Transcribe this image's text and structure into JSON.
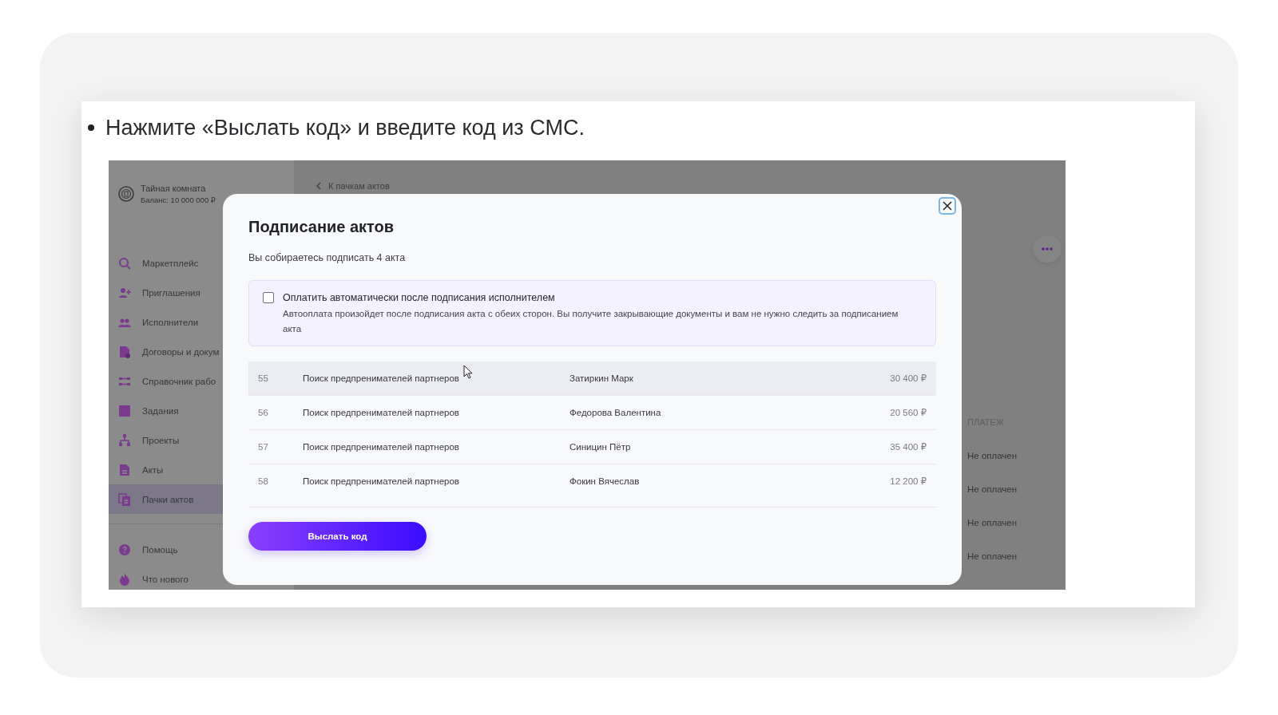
{
  "instruction": "Нажмите «Выслать код» и введите код из СМС.",
  "screenshot": {
    "sidebar": {
      "account": {
        "name": "Тайная комната",
        "balance": "Баланс: 10 000 000 ₽"
      },
      "items": [
        {
          "label": "Маркетплейс",
          "selected": false
        },
        {
          "label": "Приглашения",
          "selected": false
        },
        {
          "label": "Исполнители",
          "selected": false
        },
        {
          "label": "Договоры и докум",
          "selected": false
        },
        {
          "label": "Справочник рабо",
          "selected": false
        },
        {
          "label": "Задания",
          "selected": false
        },
        {
          "label": "Проекты",
          "selected": false
        },
        {
          "label": "Акты",
          "selected": false
        },
        {
          "label": "Пачки актов",
          "selected": true
        }
      ],
      "footer_items": [
        {
          "label": "Помощь",
          "selected": false
        },
        {
          "label": "Что нового",
          "selected": false
        }
      ]
    },
    "main": {
      "back_link": "К пачкам актов",
      "payment_column": {
        "header": "ПЛАТЕЖ",
        "values": [
          "Не оплачен",
          "Не оплачен",
          "Не оплачен",
          "Не оплачен"
        ]
      }
    },
    "modal": {
      "title": "Подписание актов",
      "subtitle": "Вы собираетесь подписать 4 акта",
      "auto_pay": {
        "checked": false,
        "label": "Оплатить автоматически после подписания исполнителем",
        "description": "Автооплата произойдет после подписания акта с обеих сторон. Вы получите закрывающие документы и вам не нужно следить за подписанием акта"
      },
      "table": {
        "rows": [
          {
            "number": "55",
            "task": "Поиск предпренимателей партнеров",
            "performer": "Затиркин Марк",
            "amount": "30 400 ₽",
            "hovered": true
          },
          {
            "number": "56",
            "task": "Поиск предпренимателей партнеров",
            "performer": "Федорова Валентина",
            "amount": "20 560 ₽",
            "hovered": false
          },
          {
            "number": "57",
            "task": "Поиск предпренимателей партнеров",
            "performer": "Синицин Пётр",
            "amount": "35 400 ₽",
            "hovered": false
          },
          {
            "number": "58",
            "task": "Поиск предпренимателей партнеров",
            "performer": "Фокин Вячеслав",
            "amount": "12 200 ₽",
            "hovered": false
          }
        ]
      },
      "button": "Выслать код"
    }
  }
}
